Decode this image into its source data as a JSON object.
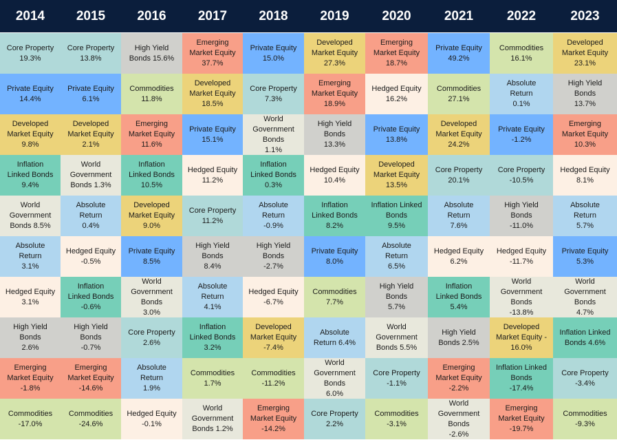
{
  "chart_data": {
    "type": "table",
    "title": "",
    "colors": {
      "header": "#0b1e3c",
      "Core Property": "#b0d9d9",
      "Private Equity": "#73b3ff",
      "Developed Market Equity": "#ecd37a",
      "Inflation Linked Bonds": "#76cfb8",
      "World Government Bonds": "#e8e8dc",
      "Absolute Return": "#b0d6ef",
      "Hedged Equity": "#fdf0e4",
      "High Yield Bonds": "#d0d0cc",
      "Emerging Market Equity": "#f89f88",
      "Commodities": "#d4e4ac"
    },
    "columns": [
      {
        "year": "2014",
        "cells": [
          {
            "asset": "Core Property",
            "label": "Core Property\n19.3%",
            "value": 19.3
          },
          {
            "asset": "Private Equity",
            "label": "Private Equity\n14.4%",
            "value": 14.4
          },
          {
            "asset": "Developed Market Equity",
            "label": "Developed\nMarket Equity\n9.8%",
            "value": 9.8
          },
          {
            "asset": "Inflation Linked Bonds",
            "label": "Inflation\nLinked Bonds\n9.4%",
            "value": 9.4
          },
          {
            "asset": "World Government Bonds",
            "label": "World\nGovernment\nBonds 8.5%",
            "value": 8.5
          },
          {
            "asset": "Absolute Return",
            "label": "Absolute\nReturn\n3.1%",
            "value": 3.1
          },
          {
            "asset": "Hedged Equity",
            "label": "Hedged Equity\n3.1%",
            "value": 3.1
          },
          {
            "asset": "High Yield Bonds",
            "label": "High Yield\nBonds\n2.6%",
            "value": 2.6
          },
          {
            "asset": "Emerging Market Equity",
            "label": "Emerging\nMarket Equity\n-1.8%",
            "value": -1.8
          },
          {
            "asset": "Commodities",
            "label": "Commodities\n-17.0%",
            "value": -17.0
          }
        ]
      },
      {
        "year": "2015",
        "cells": [
          {
            "asset": "Core Property",
            "label": "Core Property\n13.8%",
            "value": 13.8
          },
          {
            "asset": "Private Equity",
            "label": "Private Equity\n6.1%",
            "value": 6.1
          },
          {
            "asset": "Developed Market Equity",
            "label": "Developed\nMarket Equity\n2.1%",
            "value": 2.1
          },
          {
            "asset": "World Government Bonds",
            "label": "World\nGovernment\nBonds 1.3%",
            "value": 1.3
          },
          {
            "asset": "Absolute Return",
            "label": "Absolute\nReturn\n0.4%",
            "value": 0.4
          },
          {
            "asset": "Hedged Equity",
            "label": "Hedged Equity\n-0.5%",
            "value": -0.5
          },
          {
            "asset": "Inflation Linked Bonds",
            "label": "Inflation\nLinked Bonds\n-0.6%",
            "value": -0.6
          },
          {
            "asset": "High Yield Bonds",
            "label": "High Yield\nBonds\n-0.7%",
            "value": -0.7
          },
          {
            "asset": "Emerging Market Equity",
            "label": "Emerging\nMarket Equity\n-14.6%",
            "value": -14.6
          },
          {
            "asset": "Commodities",
            "label": "Commodities\n-24.6%",
            "value": -24.6
          }
        ]
      },
      {
        "year": "2016",
        "cells": [
          {
            "asset": "High Yield Bonds",
            "label": "High Yield\nBonds 15.6%",
            "value": 15.6
          },
          {
            "asset": "Commodities",
            "label": "Commodities\n11.8%",
            "value": 11.8
          },
          {
            "asset": "Emerging Market Equity",
            "label": "Emerging\nMarket Equity\n11.6%",
            "value": 11.6
          },
          {
            "asset": "Inflation Linked Bonds",
            "label": "Inflation\nLinked Bonds\n10.5%",
            "value": 10.5
          },
          {
            "asset": "Developed Market Equity",
            "label": "Developed\nMarket Equity\n9.0%",
            "value": 9.0
          },
          {
            "asset": "Private Equity",
            "label": "Private Equity\n8.5%",
            "value": 8.5
          },
          {
            "asset": "World Government Bonds",
            "label": "World\nGovernment\nBonds\n3.0%",
            "value": 3.0
          },
          {
            "asset": "Core Property",
            "label": "Core Property\n2.6%",
            "value": 2.6
          },
          {
            "asset": "Absolute Return",
            "label": "Absolute\nReturn\n1.9%",
            "value": 1.9
          },
          {
            "asset": "Hedged Equity",
            "label": "Hedged Equity\n-0.1%",
            "value": -0.1
          }
        ]
      },
      {
        "year": "2017",
        "cells": [
          {
            "asset": "Emerging Market Equity",
            "label": "Emerging\nMarket Equity\n37.7%",
            "value": 37.7
          },
          {
            "asset": "Developed Market Equity",
            "label": "Developed\nMarket Equity\n18.5%",
            "value": 18.5
          },
          {
            "asset": "Private Equity",
            "label": "Private Equity\n15.1%",
            "value": 15.1
          },
          {
            "asset": "Hedged Equity",
            "label": "Hedged Equity\n11.2%",
            "value": 11.2
          },
          {
            "asset": "Core Property",
            "label": "Core Property\n11.2%",
            "value": 11.2
          },
          {
            "asset": "High Yield Bonds",
            "label": "High Yield\nBonds\n8.4%",
            "value": 8.4
          },
          {
            "asset": "Absolute Return",
            "label": "Absolute\nReturn\n4.1%",
            "value": 4.1
          },
          {
            "asset": "Inflation Linked Bonds",
            "label": "Inflation\nLinked Bonds\n3.2%",
            "value": 3.2
          },
          {
            "asset": "Commodities",
            "label": "Commodities\n1.7%",
            "value": 1.7
          },
          {
            "asset": "World Government Bonds",
            "label": "World\nGovernment\nBonds 1.2%",
            "value": 1.2
          }
        ]
      },
      {
        "year": "2018",
        "cells": [
          {
            "asset": "Private Equity",
            "label": "Private Equity\n15.0%",
            "value": 15.0
          },
          {
            "asset": "Core Property",
            "label": "Core Property\n7.3%",
            "value": 7.3
          },
          {
            "asset": "World Government Bonds",
            "label": "World\nGovernment\nBonds\n1.1%",
            "value": 1.1
          },
          {
            "asset": "Inflation Linked Bonds",
            "label": "Inflation\nLinked Bonds\n0.3%",
            "value": 0.3
          },
          {
            "asset": "Absolute Return",
            "label": "Absolute\nReturn\n-0.9%",
            "value": -0.9
          },
          {
            "asset": "High Yield Bonds",
            "label": "High Yield\nBonds\n-2.7%",
            "value": -2.7
          },
          {
            "asset": "Hedged Equity",
            "label": "Hedged Equity\n-6.7%",
            "value": -6.7
          },
          {
            "asset": "Developed Market Equity",
            "label": "Developed\nMarket Equity\n-7.4%",
            "value": -7.4
          },
          {
            "asset": "Commodities",
            "label": "Commodities\n-11.2%",
            "value": -11.2
          },
          {
            "asset": "Emerging Market Equity",
            "label": "Emerging\nMarket Equity\n-14.2%",
            "value": -14.2
          }
        ]
      },
      {
        "year": "2019",
        "cells": [
          {
            "asset": "Developed Market Equity",
            "label": "Developed\nMarket Equity\n27.3%",
            "value": 27.3
          },
          {
            "asset": "Emerging Market Equity",
            "label": "Emerging\nMarket Equity\n18.9%",
            "value": 18.9
          },
          {
            "asset": "High Yield Bonds",
            "label": "High Yield\nBonds\n13.3%",
            "value": 13.3
          },
          {
            "asset": "Hedged Equity",
            "label": "Hedged Equity\n10.4%",
            "value": 10.4
          },
          {
            "asset": "Inflation Linked Bonds",
            "label": "Inflation\nLinked Bonds\n8.2%",
            "value": 8.2
          },
          {
            "asset": "Private Equity",
            "label": "Private Equity\n8.0%",
            "value": 8.0
          },
          {
            "asset": "Commodities",
            "label": "Commodities\n7.7%",
            "value": 7.7
          },
          {
            "asset": "Absolute Return",
            "label": "Absolute\nReturn 6.4%",
            "value": 6.4
          },
          {
            "asset": "World Government Bonds",
            "label": "World\nGovernment\nBonds\n6.0%",
            "value": 6.0
          },
          {
            "asset": "Core Property",
            "label": "Core Property\n2.2%",
            "value": 2.2
          }
        ]
      },
      {
        "year": "2020",
        "cells": [
          {
            "asset": "Emerging Market Equity",
            "label": "Emerging\nMarket Equity\n18.7%",
            "value": 18.7
          },
          {
            "asset": "Hedged Equity",
            "label": "Hedged Equity\n16.2%",
            "value": 16.2
          },
          {
            "asset": "Private Equity",
            "label": "Private Equity\n13.8%",
            "value": 13.8
          },
          {
            "asset": "Developed Market Equity",
            "label": "Developed\nMarket Equity\n13.5%",
            "value": 13.5
          },
          {
            "asset": "Inflation Linked Bonds",
            "label": "Inflation Linked\nBonds\n9.5%",
            "value": 9.5
          },
          {
            "asset": "Absolute Return",
            "label": "Absolute\nReturn\n6.5%",
            "value": 6.5
          },
          {
            "asset": "High Yield Bonds",
            "label": "High Yield\nBonds\n5.7%",
            "value": 5.7
          },
          {
            "asset": "World Government Bonds",
            "label": "World\nGovernment\nBonds 5.5%",
            "value": 5.5
          },
          {
            "asset": "Core Property",
            "label": "Core Property\n-1.1%",
            "value": -1.1
          },
          {
            "asset": "Commodities",
            "label": "Commodities\n-3.1%",
            "value": -3.1
          }
        ]
      },
      {
        "year": "2021",
        "cells": [
          {
            "asset": "Private Equity",
            "label": "Private Equity\n49.2%",
            "value": 49.2
          },
          {
            "asset": "Commodities",
            "label": "Commodities\n27.1%",
            "value": 27.1
          },
          {
            "asset": "Developed Market Equity",
            "label": "Developed\nMarket Equity\n24.2%",
            "value": 24.2
          },
          {
            "asset": "Core Property",
            "label": "Core Property\n20.1%",
            "value": 20.1
          },
          {
            "asset": "Absolute Return",
            "label": "Absolute\nReturn\n7.6%",
            "value": 7.6
          },
          {
            "asset": "Hedged Equity",
            "label": "Hedged Equity\n6.2%",
            "value": 6.2
          },
          {
            "asset": "Inflation Linked Bonds",
            "label": "Inflation\nLinked Bonds\n5.4%",
            "value": 5.4
          },
          {
            "asset": "High Yield Bonds",
            "label": "High Yield\nBonds 2.5%",
            "value": 2.5
          },
          {
            "asset": "Emerging Market Equity",
            "label": "Emerging\nMarket Equity\n-2.2%",
            "value": -2.2
          },
          {
            "asset": "World Government Bonds",
            "label": "World\nGovernment\nBonds\n-2.6%",
            "value": -2.6
          }
        ]
      },
      {
        "year": "2022",
        "cells": [
          {
            "asset": "Commodities",
            "label": "Commodities\n16.1%",
            "value": 16.1
          },
          {
            "asset": "Absolute Return",
            "label": "Absolute\nReturn\n0.1%",
            "value": 0.1
          },
          {
            "asset": "Private Equity",
            "label": "Private Equity\n-1.2%",
            "value": -1.2
          },
          {
            "asset": "Core Property",
            "label": "Core Property\n-10.5%",
            "value": -10.5
          },
          {
            "asset": "High Yield Bonds",
            "label": "High Yield\nBonds\n-11.0%",
            "value": -11.0
          },
          {
            "asset": "Hedged Equity",
            "label": "Hedged Equity\n-11.7%",
            "value": -11.7
          },
          {
            "asset": "World Government Bonds",
            "label": "World\nGovernment\nBonds\n-13.8%",
            "value": -13.8
          },
          {
            "asset": "Developed Market Equity",
            "label": "Developed\nMarket Equity -\n16.0%",
            "value": -16.0
          },
          {
            "asset": "Inflation Linked Bonds",
            "label": "Inflation Linked\nBonds\n-17.4%",
            "value": -17.4
          },
          {
            "asset": "Emerging Market Equity",
            "label": "Emerging\nMarket Equity\n-19.7%",
            "value": -19.7
          }
        ]
      },
      {
        "year": "2023",
        "cells": [
          {
            "asset": "Developed Market Equity",
            "label": "Developed\nMarket Equity\n23.1%",
            "value": 23.1
          },
          {
            "asset": "High Yield Bonds",
            "label": "High Yield\nBonds\n13.7%",
            "value": 13.7
          },
          {
            "asset": "Emerging Market Equity",
            "label": "Emerging\nMarket Equity\n10.3%",
            "value": 10.3
          },
          {
            "asset": "Hedged Equity",
            "label": "Hedged Equity\n8.1%",
            "value": 8.1
          },
          {
            "asset": "Absolute Return",
            "label": "Absolute\nReturn\n5.7%",
            "value": 5.7
          },
          {
            "asset": "Private Equity",
            "label": "Private Equity\n5.3%",
            "value": 5.3
          },
          {
            "asset": "World Government Bonds",
            "label": "World\nGovernment\nBonds\n4.7%",
            "value": 4.7
          },
          {
            "asset": "Inflation Linked Bonds",
            "label": "Inflation Linked\nBonds 4.6%",
            "value": 4.6
          },
          {
            "asset": "Core Property",
            "label": "Core Property\n-3.4%",
            "value": -3.4
          },
          {
            "asset": "Commodities",
            "label": "Commodities\n-9.3%",
            "value": -9.3
          }
        ]
      }
    ]
  }
}
